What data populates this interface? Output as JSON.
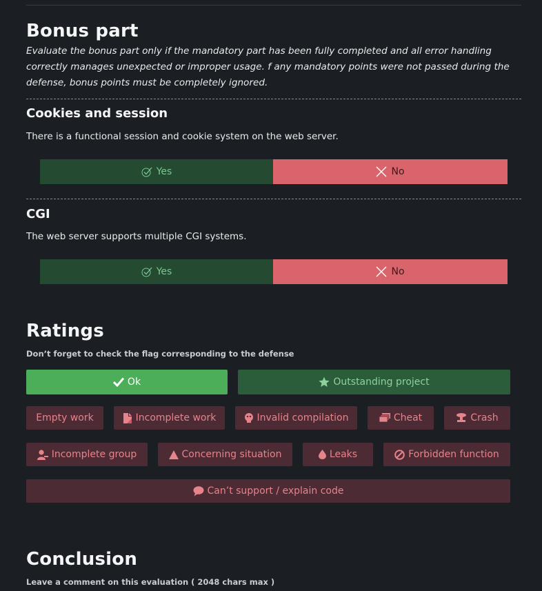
{
  "bonus": {
    "title": "Bonus part",
    "description": "Evaluate the bonus part only if the mandatory part has been fully completed and all error handling correctly manages unexpected or improper usage. f any mandatory points were not passed during the defense, bonus points must be completely ignored."
  },
  "questions": [
    {
      "title": "Cookies and session",
      "text": "There is a functional session and cookie system on the web server.",
      "yes_label": "Yes",
      "no_label": "No"
    },
    {
      "title": "CGI",
      "text": "The web server supports multiple CGI systems.",
      "yes_label": "Yes",
      "no_label": "No"
    }
  ],
  "ratings": {
    "title": "Ratings",
    "note": "Don’t forget to check the flag corresponding to the defense",
    "flags": {
      "ok": {
        "label": "Ok",
        "icon": "check-icon"
      },
      "outstanding": {
        "label": "Outstanding project",
        "icon": "star-icon"
      },
      "empty": {
        "label": "Empty work"
      },
      "incomplete_work": {
        "label": "Incomplete work",
        "icon": "document-icon"
      },
      "invalid_compilation": {
        "label": "Invalid compilation",
        "icon": "bug-icon"
      },
      "cheat": {
        "label": "Cheat",
        "icon": "stack-icon"
      },
      "crash": {
        "label": "Crash",
        "icon": "explosion-icon"
      },
      "incomplete_group": {
        "label": "Incomplete group",
        "icon": "user-minus-icon"
      },
      "concerning": {
        "label": "Concerning situation",
        "icon": "warning-icon"
      },
      "leaks": {
        "label": "Leaks",
        "icon": "drop-icon"
      },
      "forbidden": {
        "label": "Forbidden function",
        "icon": "ban-icon"
      },
      "cant_support": {
        "label": "Can’t support / explain code",
        "icon": "speech-bubble-icon"
      }
    }
  },
  "conclusion": {
    "title": "Conclusion",
    "note": "Leave a comment on this evaluation ( 2048 chars max )"
  },
  "colors": {
    "background": "#1b1e22",
    "yes_bg": "#244a32",
    "no_bg": "#d9646c",
    "ok_bg": "#4cae58",
    "outstanding_bg": "#2c5d3a",
    "negative_flag_bg": "#4d2b34",
    "negative_flag_text": "#e6838b"
  }
}
